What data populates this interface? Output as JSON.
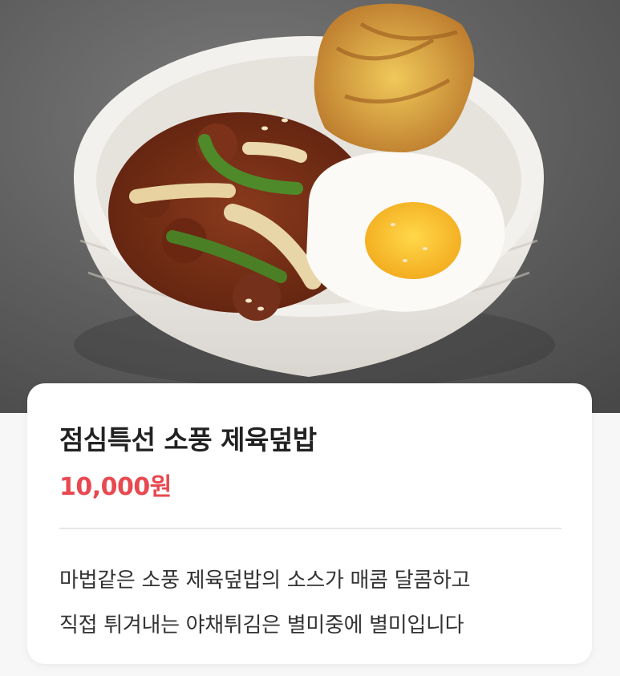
{
  "menu": {
    "image_alt": "",
    "title": "점심특선 소풍 제육덮밥",
    "price": "10,000원",
    "description_lines": [
      "마법같은 소풍 제육덮밥의 소스가 매콤 달콤하고",
      "직접 튀겨내는 야채튀김은 별미중에 별미입니다"
    ]
  },
  "colors": {
    "price": "#e8484f",
    "card_background": "#ffffff",
    "page_background": "#f7f7f7"
  }
}
